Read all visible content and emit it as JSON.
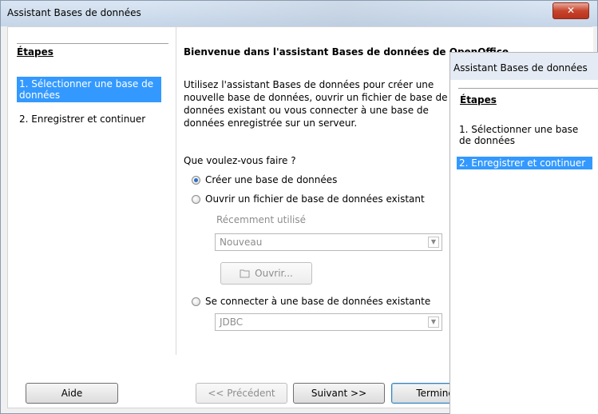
{
  "window": {
    "title": "Assistant Bases de données",
    "close_glyph": "✕"
  },
  "left": {
    "steps_title": "Étapes",
    "steps": [
      {
        "label": "1. Sélectionner une base de données",
        "active": true
      },
      {
        "label": "2. Enregistrer et continuer",
        "active": false
      }
    ]
  },
  "main": {
    "heading": "Bienvenue dans l'assistant Bases de données de OpenOffice",
    "description": "Utilisez l'assistant Bases de données pour créer une nouvelle base de données, ouvrir un fichier de base de données existant ou vous connecter à une base de données enregistrée sur un serveur.",
    "question": "Que voulez-vous faire ?",
    "options": [
      {
        "label": "Créer une base de données",
        "checked": true
      },
      {
        "label": "Ouvrir un fichier de base de données existant",
        "checked": false
      },
      {
        "label": "Se connecter à une base de données existante",
        "checked": false
      }
    ],
    "recent_label": "Récemment utilisé",
    "recent_value": "Nouveau",
    "open_button": "Ouvrir...",
    "connection_value": "JDBC"
  },
  "buttons": {
    "help": "Aide",
    "previous": "<< Précédent",
    "next": "Suivant >>",
    "finish": "Terminer"
  },
  "overlay": {
    "title": "Assistant Bases de données",
    "steps_title": "Étapes",
    "steps": [
      {
        "label": "1. Sélectionner une base de données",
        "active": false
      },
      {
        "label": "2. Enregistrer et continuer",
        "active": true
      }
    ]
  },
  "colors": {
    "selection": "#3399ff",
    "close_button": "#c7442c"
  }
}
